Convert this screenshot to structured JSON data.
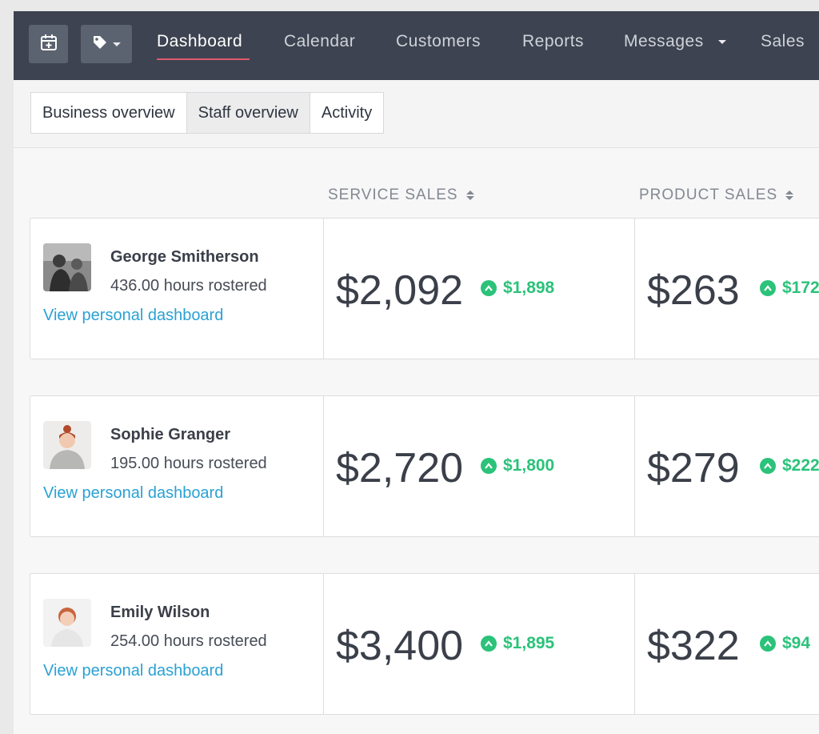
{
  "nav": {
    "links": [
      "Dashboard",
      "Calendar",
      "Customers",
      "Reports",
      "Messages",
      "Sales"
    ],
    "active": "Dashboard",
    "accent": "#e0596b",
    "background": "#3d4350",
    "icons": [
      "calendar-plus-icon",
      "tag-icon"
    ]
  },
  "tabs": {
    "items": [
      "Business overview",
      "Staff overview",
      "Activity"
    ],
    "active": "Staff overview"
  },
  "columns": {
    "service": "SERVICE SALES",
    "product": "PRODUCT SALES"
  },
  "link_text": "View personal dashboard",
  "colors": {
    "link": "#2aa1d3",
    "positive": "#2bc27a"
  },
  "staff": [
    {
      "name": "George Smitherson",
      "hours": "436.00 hours rostered",
      "service_sales": "$2,092",
      "service_delta": "$1,898",
      "product_sales": "$263",
      "product_delta": "$172"
    },
    {
      "name": "Sophie Granger",
      "hours": "195.00 hours rostered",
      "service_sales": "$2,720",
      "service_delta": "$1,800",
      "product_sales": "$279",
      "product_delta": "$222"
    },
    {
      "name": "Emily Wilson",
      "hours": "254.00 hours rostered",
      "service_sales": "$3,400",
      "service_delta": "$1,895",
      "product_sales": "$322",
      "product_delta": "$94"
    }
  ]
}
